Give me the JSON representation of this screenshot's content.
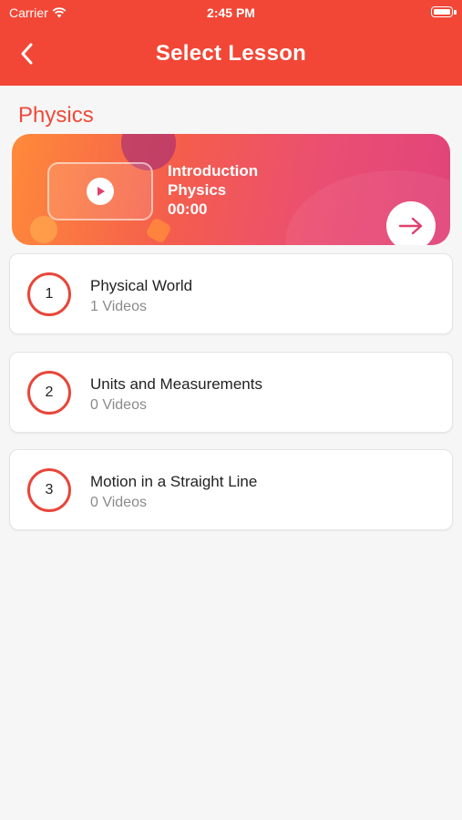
{
  "status_bar": {
    "carrier": "Carrier",
    "time": "2:45 PM"
  },
  "header": {
    "title": "Select Lesson",
    "bg_color": "#f24737"
  },
  "section": {
    "title": "Physics"
  },
  "banner": {
    "line1": "Introduction",
    "line2": "Physics",
    "duration": "00:00"
  },
  "lessons": [
    {
      "number": "1",
      "name": "Physical World",
      "count": "1 Videos"
    },
    {
      "number": "2",
      "name": "Units and Measurements",
      "count": "0 Videos"
    },
    {
      "number": "3",
      "name": "Motion in a Straight Line",
      "count": "0 Videos"
    }
  ],
  "colors": {
    "accent": "#ef4a3a",
    "muted_text": "#8a8a8a"
  },
  "icons": {
    "back": "chevron-left-icon",
    "wifi": "wifi-icon",
    "battery": "battery-icon",
    "play": "play-icon",
    "next": "arrow-right-icon"
  }
}
